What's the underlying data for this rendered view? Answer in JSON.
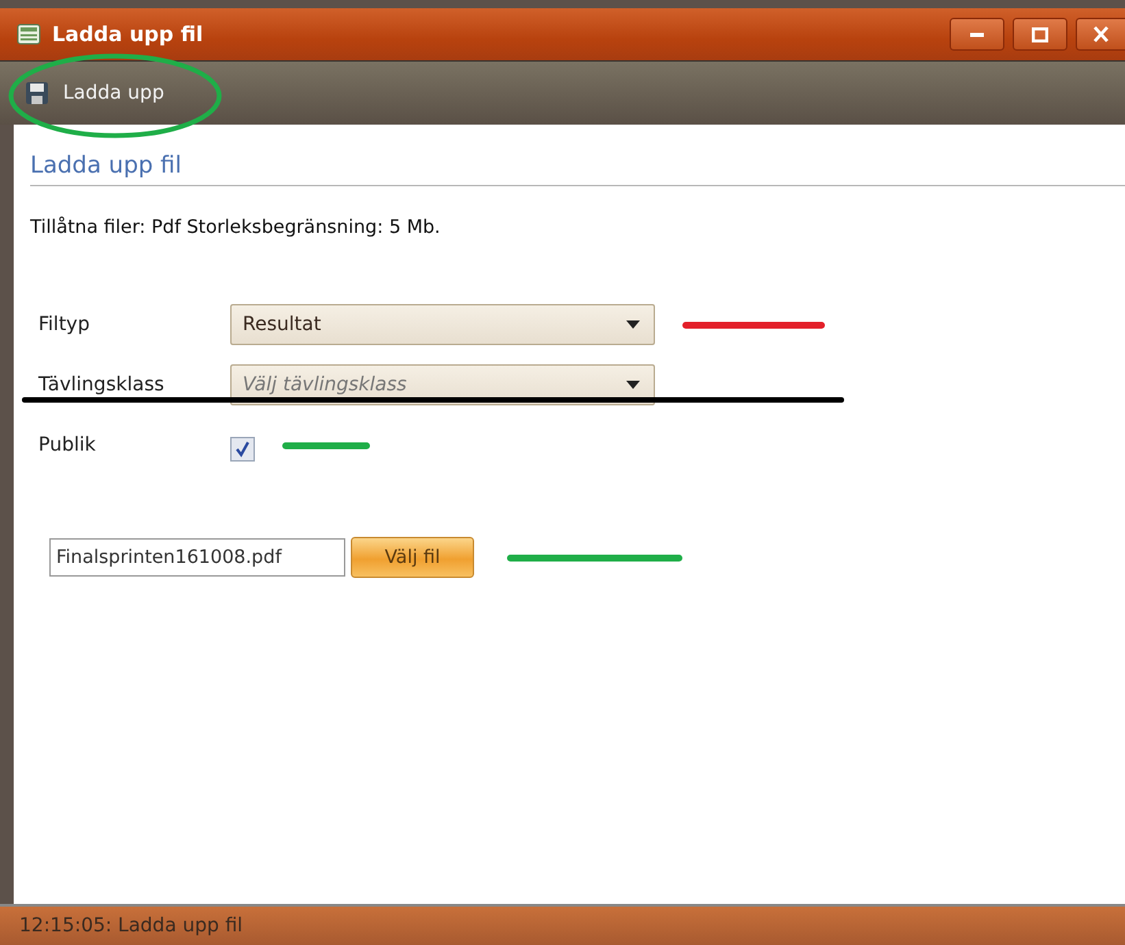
{
  "window": {
    "title": "Ladda upp fil"
  },
  "toolbar": {
    "items": [
      {
        "label": "Ladda upp",
        "circled": true
      }
    ]
  },
  "page": {
    "heading": "Ladda upp fil",
    "info": "Tillåtna filer: Pdf Storleksbegränsning: 5 Mb."
  },
  "fields": [
    {
      "kind": "select",
      "label": "Filtyp",
      "value": "Resultat",
      "marker": {
        "color": "#e3202a"
      },
      "struck": false
    },
    {
      "kind": "select",
      "label": "Tävlingsklass",
      "placeholder": "Välj tävlingsklass",
      "struck": true
    },
    {
      "kind": "checkbox",
      "label": "Publik",
      "checked": true,
      "marker": {
        "color": "#1fae48"
      },
      "struck": false
    }
  ],
  "file": {
    "value": "Finalsprinten161008.pdf",
    "button": "Välj fil",
    "marker": {
      "color": "#1fae48"
    }
  },
  "status_bar": {
    "text": "12:15:05: Ladda upp fil"
  }
}
